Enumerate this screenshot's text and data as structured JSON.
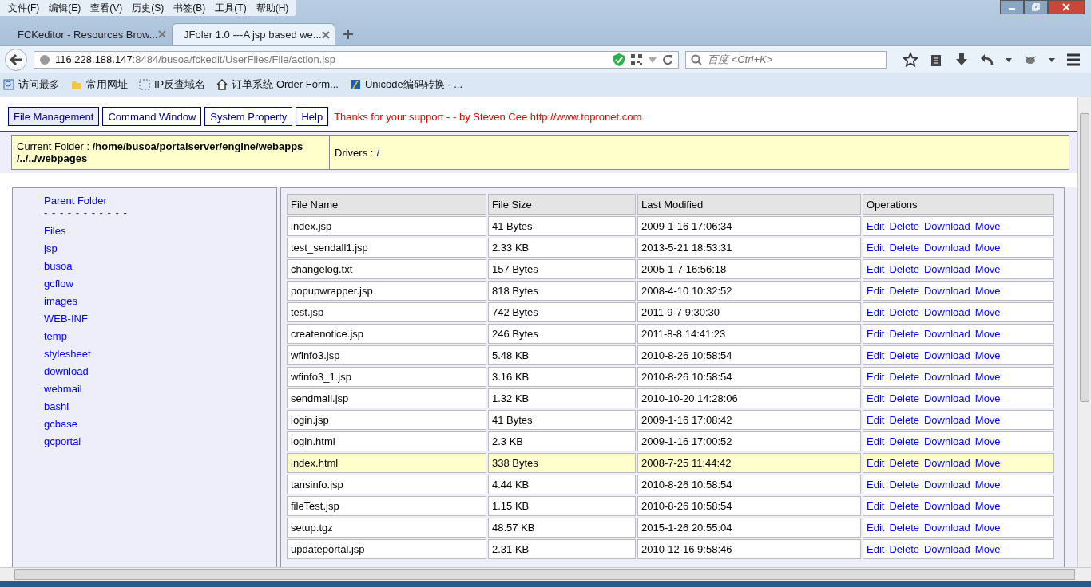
{
  "menu_bar": [
    "文件(F)",
    "编辑(E)",
    "查看(V)",
    "历史(S)",
    "书签(B)",
    "工具(T)",
    "帮助(H)"
  ],
  "tabs": [
    {
      "label": "FCKeditor - Resources Brow...",
      "selected": false
    },
    {
      "label": "JFoler 1.0 ---A jsp based we...",
      "selected": true
    }
  ],
  "address_bar": {
    "host": "116.228.188.147",
    "path": ":8484/busoa/fckedit/UserFiles/File/action.jsp"
  },
  "search": {
    "placeholder": "百度 <Ctrl+K>"
  },
  "bookmarks": [
    {
      "label": "访问最多",
      "kind": "page"
    },
    {
      "label": "常用网址",
      "kind": "folder"
    },
    {
      "label": "IP反查域名",
      "kind": "dashed"
    },
    {
      "label": "订单系统 Order Form...",
      "kind": "home"
    },
    {
      "label": "Unicode编码转换 - ...",
      "kind": "app"
    }
  ],
  "page": {
    "nav_buttons": [
      {
        "label": "File Management",
        "selected": true
      },
      {
        "label": "Command Window",
        "selected": false
      },
      {
        "label": "System Property",
        "selected": false
      },
      {
        "label": "Help",
        "selected": false
      }
    ],
    "credit": "Thanks for your support - - by Steven Cee http://www.topronet.com",
    "current_folder_label": "Current Folder :",
    "current_folder": "/home/busoa/portalserver/engine/webapps /../../webpages",
    "drivers_label": "Drivers :",
    "drivers": "/",
    "parent_folder": "Parent Folder",
    "separator": "- - - - - - - - - - -",
    "folders_heading": "Files",
    "folders": [
      "jsp",
      "busoa",
      "gcflow",
      "images",
      "WEB-INF",
      "temp",
      "stylesheet",
      "download",
      "webmail",
      "bashi",
      "gcbase",
      "gcportal"
    ],
    "table": {
      "columns": [
        "File Name",
        "File Size",
        "Last Modified",
        "Operations"
      ],
      "rows": [
        {
          "name": "index.jsp",
          "size": "41 Bytes",
          "modified": "2009-1-16 17:06:34",
          "selected": false,
          "operations": [
            "Edit",
            "Delete",
            "Download",
            "Move"
          ]
        },
        {
          "name": "test_sendall1.jsp",
          "size": "2.33 KB",
          "modified": "2013-5-21 18:53:31",
          "selected": false,
          "operations": [
            "Edit",
            "Delete",
            "Download",
            "Move"
          ]
        },
        {
          "name": "changelog.txt",
          "size": "157 Bytes",
          "modified": "2005-1-7 16:56:18",
          "selected": false,
          "operations": [
            "Edit",
            "Delete",
            "Download",
            "Move"
          ]
        },
        {
          "name": "popupwrapper.jsp",
          "size": "818 Bytes",
          "modified": "2008-4-10 10:32:52",
          "selected": false,
          "operations": [
            "Edit",
            "Delete",
            "Download",
            "Move"
          ]
        },
        {
          "name": "test.jsp",
          "size": "742 Bytes",
          "modified": "2011-9-7 9:30:30",
          "selected": false,
          "operations": [
            "Edit",
            "Delete",
            "Download",
            "Move"
          ]
        },
        {
          "name": "createnotice.jsp",
          "size": "246 Bytes",
          "modified": "2011-8-8 14:41:23",
          "selected": false,
          "operations": [
            "Edit",
            "Delete",
            "Download",
            "Move"
          ]
        },
        {
          "name": "wfinfo3.jsp",
          "size": "5.48 KB",
          "modified": "2010-8-26 10:58:54",
          "selected": false,
          "operations": [
            "Edit",
            "Delete",
            "Download",
            "Move"
          ]
        },
        {
          "name": "wfinfo3_1.jsp",
          "size": "3.16 KB",
          "modified": "2010-8-26 10:58:54",
          "selected": false,
          "operations": [
            "Edit",
            "Delete",
            "Download",
            "Move"
          ]
        },
        {
          "name": "sendmail.jsp",
          "size": "1.32 KB",
          "modified": "2010-10-20 14:28:06",
          "selected": false,
          "operations": [
            "Edit",
            "Delete",
            "Download",
            "Move"
          ]
        },
        {
          "name": "login.jsp",
          "size": "41 Bytes",
          "modified": "2009-1-16 17:08:42",
          "selected": false,
          "operations": [
            "Edit",
            "Delete",
            "Download",
            "Move"
          ]
        },
        {
          "name": "login.html",
          "size": "2.3 KB",
          "modified": "2009-1-16 17:00:52",
          "selected": false,
          "operations": [
            "Edit",
            "Delete",
            "Download",
            "Move"
          ]
        },
        {
          "name": "index.html",
          "size": "338 Bytes",
          "modified": "2008-7-25 11:44:42",
          "selected": true,
          "operations": [
            "Edit",
            "Delete",
            "Download",
            "Move"
          ]
        },
        {
          "name": "tansinfo.jsp",
          "size": "4.44 KB",
          "modified": "2010-8-26 10:58:54",
          "selected": false,
          "operations": [
            "Edit",
            "Delete",
            "Download",
            "Move"
          ]
        },
        {
          "name": "fileTest.jsp",
          "size": "1.15 KB",
          "modified": "2010-8-26 10:58:54",
          "selected": false,
          "operations": [
            "Edit",
            "Delete",
            "Download",
            "Move"
          ]
        },
        {
          "name": "setup.tgz",
          "size": "48.57 KB",
          "modified": "2015-1-26 20:55:04",
          "selected": false,
          "operations": [
            "Edit",
            "Delete",
            "Download",
            "Move"
          ]
        },
        {
          "name": "updateportal.jsp",
          "size": "2.31 KB",
          "modified": "2010-12-16 9:58:46",
          "selected": false,
          "operations": [
            "Edit",
            "Delete",
            "Download",
            "Move"
          ]
        }
      ]
    }
  }
}
